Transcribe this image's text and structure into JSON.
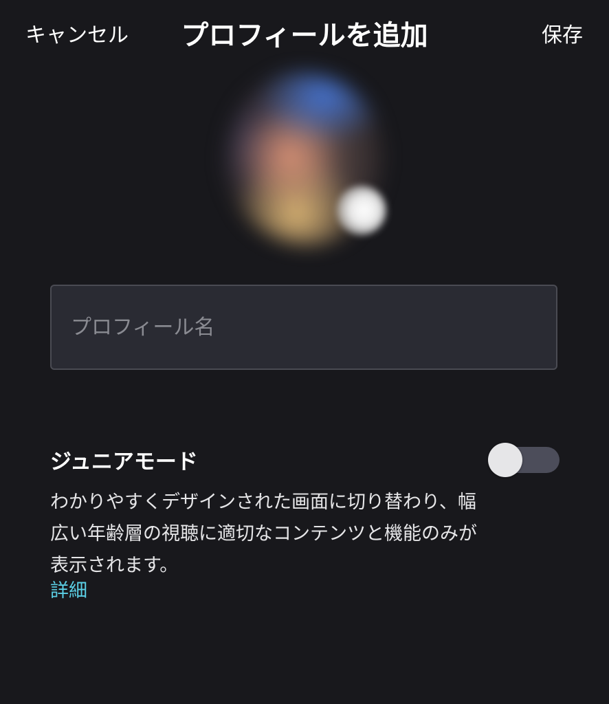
{
  "nav": {
    "cancel_label": "キャンセル",
    "title": "プロフィールを追加",
    "save_label": "保存"
  },
  "avatar": {
    "icon": "avatar-blurred-image"
  },
  "profile_name": {
    "placeholder": "プロフィール名",
    "value": ""
  },
  "junior_mode": {
    "title": "ジュニアモード",
    "enabled": false,
    "description": "わかりやすくデザインされた画面に切り替わり、幅広い年齢層の視聴に適切なコンテンツと機能のみが表示されます。",
    "details_link": "詳細"
  },
  "colors": {
    "background": "#18181c",
    "input_background": "#2a2b33",
    "input_border": "#4a4b53",
    "link": "#5bd0e6",
    "toggle_track_off": "#4c4d5a"
  }
}
